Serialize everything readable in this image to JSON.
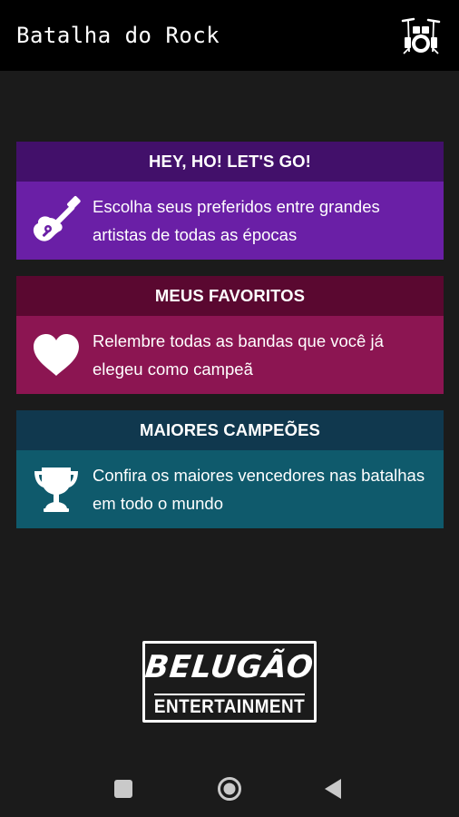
{
  "appbar": {
    "title": "Batalha do Rock",
    "action_icon": "drum-kit-icon"
  },
  "cards": [
    {
      "title": "HEY, HO! LET'S GO!",
      "text": "Escolha seus preferidos entre grandes artistas de todas as épocas",
      "icon": "guitar-icon",
      "header_color": "#42106a",
      "body_color": "#6a1fa6"
    },
    {
      "title": "MEUS FAVORITOS",
      "text": "Relembre todas as bandas que você já elegeu como campeã",
      "icon": "heart-icon",
      "header_color": "#5a0830",
      "body_color": "#8c1552"
    },
    {
      "title": "MAIORES CAMPEÕES",
      "text": "Confira os maiores vencedores nas batalhas em todo o mundo",
      "icon": "trophy-icon",
      "header_color": "#10384e",
      "body_color": "#0f5a6c"
    }
  ],
  "logo": {
    "top": "BELUGÃO",
    "bottom": "ENTERTAINMENT"
  },
  "navbar": {
    "recent_icon": "square-recent-apps-icon",
    "home_icon": "circle-home-icon",
    "back_icon": "triangle-back-icon"
  }
}
